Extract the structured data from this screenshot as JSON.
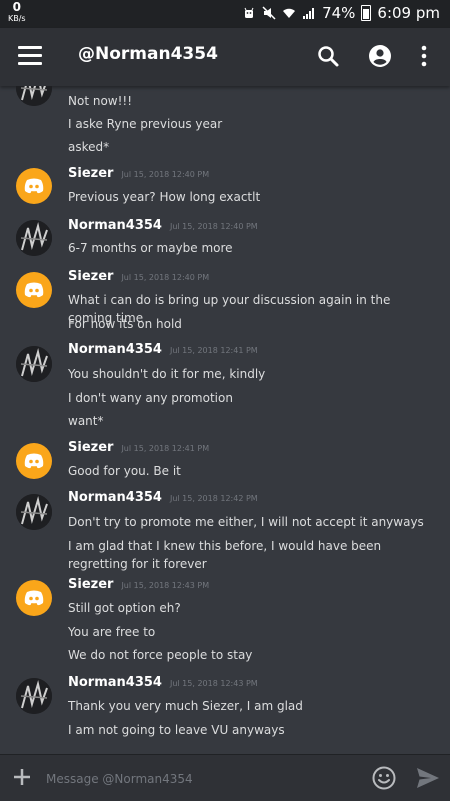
{
  "status_bar": {
    "speed_value": "0",
    "speed_unit": "KB/s",
    "battery": "74%",
    "time": "6:09 pm"
  },
  "app_bar": {
    "title": "@Norman4354",
    "icons": [
      "menu-icon",
      "search-icon",
      "profile-icon",
      "more-icon"
    ]
  },
  "messages": [
    {
      "author": "",
      "timestamp": "",
      "avatar": "norman",
      "lines": [
        "Not now!!!",
        "I aske Ryne previous year",
        "asked*"
      ]
    },
    {
      "author": "Siezer",
      "timestamp": "Jul 15, 2018 12:40 PM",
      "avatar": "discord",
      "lines": [
        "Previous year? How long exactlt"
      ]
    },
    {
      "author": "Norman4354",
      "timestamp": "Jul 15, 2018 12:40 PM",
      "avatar": "norman",
      "lines": [
        "6-7 months or maybe more"
      ]
    },
    {
      "author": "Siezer",
      "timestamp": "Jul 15, 2018 12:40 PM",
      "avatar": "discord",
      "lines": [
        "What i can do is bring up your discussion again in the coming time",
        "For now its on hold"
      ]
    },
    {
      "author": "Norman4354",
      "timestamp": "Jul 15, 2018 12:41 PM",
      "avatar": "norman",
      "lines": [
        "You shouldn't do it for me, kindly",
        "I don't wany any promotion",
        "want*"
      ]
    },
    {
      "author": "Siezer",
      "timestamp": "Jul 15, 2018 12:41 PM",
      "avatar": "discord",
      "lines": [
        "Good for you. Be it"
      ]
    },
    {
      "author": "Norman4354",
      "timestamp": "Jul 15, 2018 12:42 PM",
      "avatar": "norman",
      "lines": [
        "Don't try to promote me either, I will not accept it anyways",
        "I am glad that I knew this before, I would have been regretting for it forever"
      ]
    },
    {
      "author": "Siezer",
      "timestamp": "Jul 15, 2018 12:43 PM",
      "avatar": "discord",
      "lines": [
        "Still got option eh?",
        "You are free to",
        "We do not force people to stay"
      ]
    },
    {
      "author": "Norman4354",
      "timestamp": "Jul 15, 2018 12:43 PM",
      "avatar": "norman",
      "lines": [
        "Thank you very much Siezer, I am glad",
        "I am not going to leave VU anyways"
      ]
    }
  ],
  "composer": {
    "placeholder": "Message @Norman4354",
    "value": ""
  },
  "colors": {
    "background": "#36393f",
    "app_bar": "#2f3136",
    "discord_avatar": "#faa61a",
    "send": "#72767d"
  }
}
